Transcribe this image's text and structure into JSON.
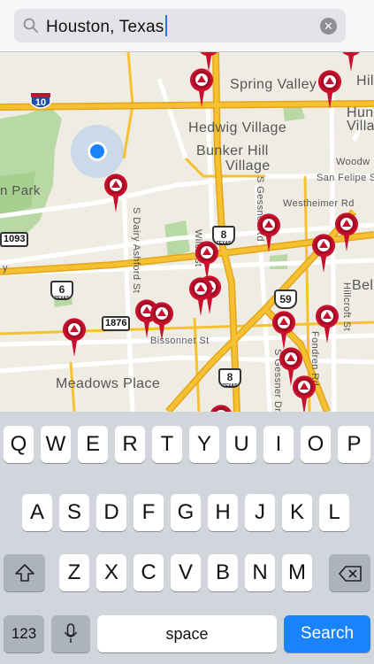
{
  "search": {
    "query": "Houston, Texas"
  },
  "map": {
    "labels": {
      "spring_valley": "Spring Valley",
      "hil": "Hil",
      "hun": "Hun",
      "villa": "Villa",
      "hedwig": "Hedwig Village",
      "bunker1": "Bunker Hill",
      "bunker2": "Village",
      "woodw": "Woodw",
      "san_felipe": "San Felipe S",
      "westheimer": "Westheimer Rd",
      "park": "n Park",
      "dairy": "S Dairy Ashford St",
      "gessner": "S Gessner Rd",
      "gessner2": "S Gessner Dr",
      "wilcrest": "Wilcrest",
      "hillcroft": "Hillcroft St",
      "fondren": "Fondren Rd",
      "bellaire": "Bel",
      "bissonnet": "Bissonnet St",
      "meadows": "Meadows Place",
      "y": "y"
    },
    "shields": {
      "i10": "10",
      "sh6": "6",
      "sh8a": "8",
      "sh8b": "8",
      "us59": "59",
      "fm1093": "1093",
      "fm1876": "1876",
      "state_abbr": "TEXAS",
      "fm_abbr": "FM"
    }
  },
  "keyboard": {
    "row1": [
      "Q",
      "W",
      "E",
      "R",
      "T",
      "Y",
      "U",
      "I",
      "O",
      "P"
    ],
    "row2": [
      "A",
      "S",
      "D",
      "F",
      "G",
      "H",
      "J",
      "K",
      "L"
    ],
    "row3": [
      "Z",
      "X",
      "C",
      "V",
      "B",
      "N",
      "M"
    ],
    "num_key": "123",
    "space_key": "space",
    "search_key": "Search"
  },
  "colors": {
    "highway": "#f5c131",
    "pin": "#c8102e",
    "location": "#1a82fb",
    "search_key": "#1a82fb"
  }
}
